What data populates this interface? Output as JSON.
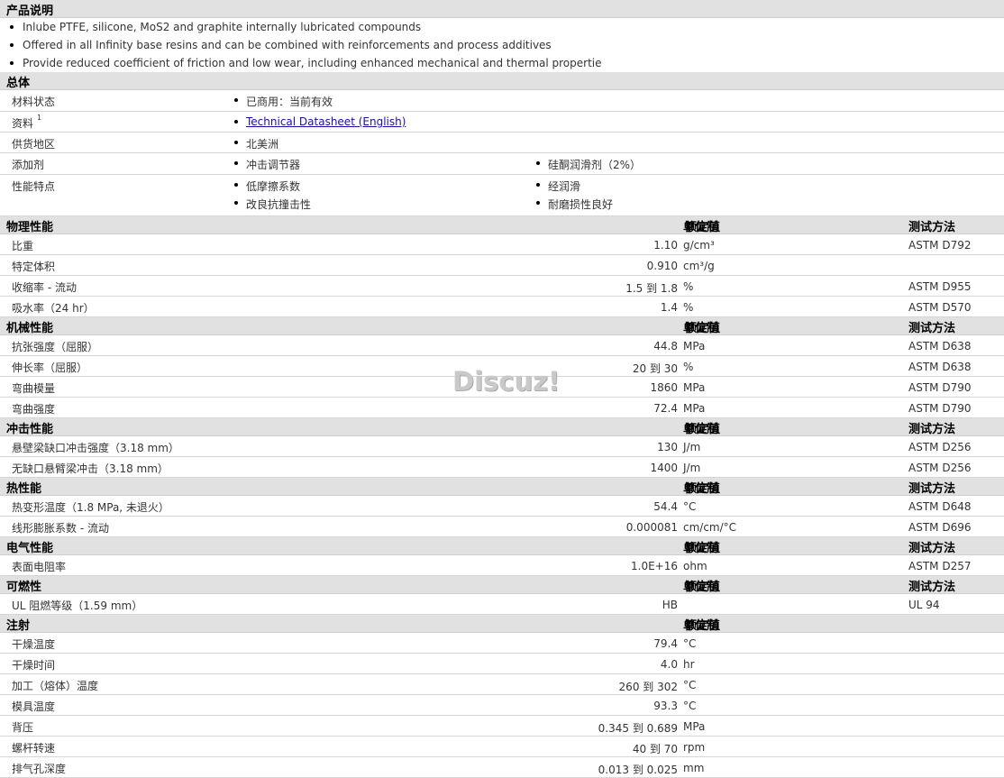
{
  "desc": {
    "title": "产品说明",
    "bullets": [
      "Inlube PTFE, silicone, MoS2 and graphite internally lubricated compounds",
      "Offered in all Infinity base resins and can be combined with reinforcements and process additives",
      "Provide reduced coefficient of friction and low wear, including enhanced mechanical and thermal propertie"
    ]
  },
  "general": {
    "title": "总体",
    "rows": [
      {
        "label": "材料状态",
        "items": [
          "已商用：当前有效"
        ]
      },
      {
        "label": "资料",
        "sup": "1",
        "link": "Technical Datasheet (English)"
      },
      {
        "label": "供货地区",
        "items": [
          "北美洲"
        ]
      },
      {
        "label": "添加剂",
        "items": [
          "冲击调节器",
          "硅酮润滑剂（2%）"
        ]
      },
      {
        "label": "性能特点",
        "items": [
          "低摩擦系数",
          "经润滑",
          "改良抗撞击性",
          "耐磨损性良好"
        ]
      }
    ]
  },
  "col_headers": {
    "nominal": "额定值",
    "unit": "单位制",
    "method": "测试方法"
  },
  "sections": [
    {
      "title": "物理性能",
      "rows": [
        {
          "label": "比重",
          "value": "1.10",
          "unit": "g/cm³",
          "method": "ASTM D792"
        },
        {
          "label": "特定体积",
          "value": "0.910",
          "unit": "cm³/g",
          "method": ""
        },
        {
          "label": "收缩率 - 流动",
          "value": "1.5 到  1.8",
          "unit": "%",
          "method": "ASTM D955"
        },
        {
          "label": "吸水率（24 hr）",
          "value": "1.4",
          "unit": "%",
          "method": "ASTM D570"
        }
      ]
    },
    {
      "title": "机械性能",
      "rows": [
        {
          "label": "抗张强度（屈服）",
          "value": "44.8",
          "unit": "MPa",
          "method": "ASTM D638"
        },
        {
          "label": "伸长率（屈服）",
          "value": "20 到  30",
          "unit": "%",
          "method": "ASTM D638"
        },
        {
          "label": "弯曲模量",
          "value": "1860",
          "unit": "MPa",
          "method": "ASTM D790"
        },
        {
          "label": "弯曲强度",
          "value": "72.4",
          "unit": "MPa",
          "method": "ASTM D790"
        }
      ]
    },
    {
      "title": "冲击性能",
      "rows": [
        {
          "label": "悬壁梁缺口冲击强度（3.18 mm）",
          "value": "130",
          "unit": "J/m",
          "method": "ASTM D256"
        },
        {
          "label": "无缺口悬臂梁冲击（3.18 mm）",
          "value": "1400",
          "unit": "J/m",
          "method": "ASTM D256"
        }
      ]
    },
    {
      "title": "热性能",
      "rows": [
        {
          "label": "热变形温度（1.8 MPa, 未退火）",
          "value": "54.4",
          "unit": "°C",
          "method": "ASTM D648"
        },
        {
          "label": "线形膨胀系数 - 流动",
          "value": "0.000081",
          "unit": "cm/cm/°C",
          "method": "ASTM D696"
        }
      ]
    },
    {
      "title": "电气性能",
      "rows": [
        {
          "label": "表面电阻率",
          "value": "1.0E+16",
          "unit": "ohm",
          "method": "ASTM D257"
        }
      ]
    },
    {
      "title": "可燃性",
      "rows": [
        {
          "label": "UL 阻燃等级（1.59 mm）",
          "value": "HB",
          "unit": "",
          "method": "UL 94"
        }
      ]
    },
    {
      "title": "注射",
      "no_method": true,
      "rows": [
        {
          "label": "干燥温度",
          "value": "79.4",
          "unit": "°C",
          "method": ""
        },
        {
          "label": "干燥时间",
          "value": "4.0",
          "unit": "hr",
          "method": ""
        },
        {
          "label": "加工（熔体）温度",
          "value": "260 到  302",
          "unit": "°C",
          "method": ""
        },
        {
          "label": "模具温度",
          "value": "93.3",
          "unit": "°C",
          "method": ""
        },
        {
          "label": "背压",
          "value": "0.345 到  0.689",
          "unit": "MPa",
          "method": ""
        },
        {
          "label": "螺杆转速",
          "value": "40 到  70",
          "unit": "rpm",
          "method": ""
        },
        {
          "label": "排气孔深度",
          "value": "0.013 到  0.025",
          "unit": "mm",
          "method": ""
        }
      ]
    }
  ],
  "watermark": "Discuz!"
}
